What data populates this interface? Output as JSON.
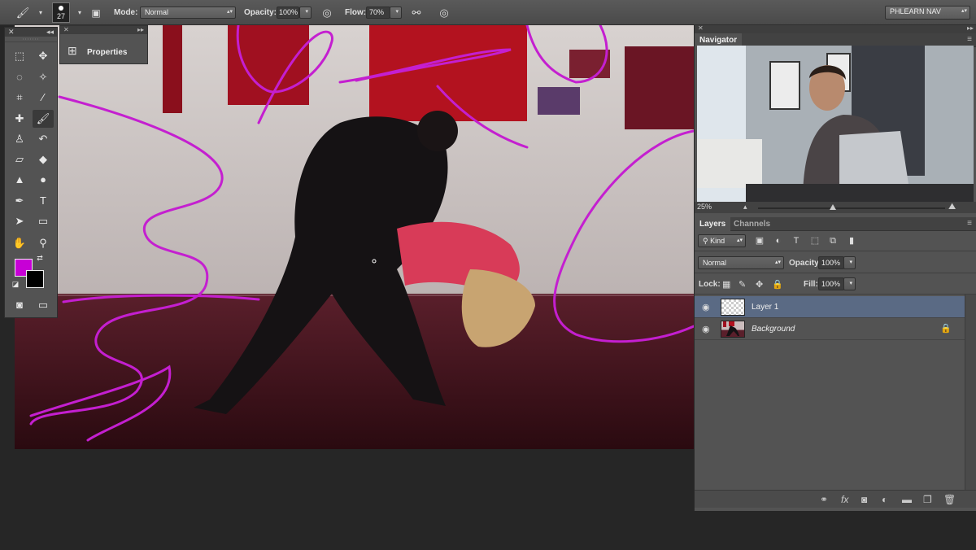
{
  "options_bar": {
    "brush_size": "27",
    "mode_label": "Mode:",
    "mode_value": "Normal",
    "opacity_label": "Opacity:",
    "opacity_value": "100%",
    "flow_label": "Flow:",
    "flow_value": "70%",
    "workspace": "PHLEARN NAV"
  },
  "properties_panel": {
    "title": "Properties"
  },
  "tools_panel": {
    "foreground_color": "#c700d6",
    "background_color": "#000000"
  },
  "navigator": {
    "title": "Navigator",
    "zoom": "25%"
  },
  "layers_panel": {
    "tabs": [
      "Layers",
      "Channels"
    ],
    "filter_kind": "Kind",
    "blend_mode": "Normal",
    "opacity_label": "Opacity:",
    "opacity_value": "100%",
    "lock_label": "Lock:",
    "fill_label": "Fill:",
    "fill_value": "100%",
    "layers": [
      {
        "name": "Layer 1",
        "selected": true,
        "locked": false
      },
      {
        "name": "Background",
        "selected": false,
        "locked": true
      }
    ]
  },
  "stroke_color": "#c41fd0"
}
